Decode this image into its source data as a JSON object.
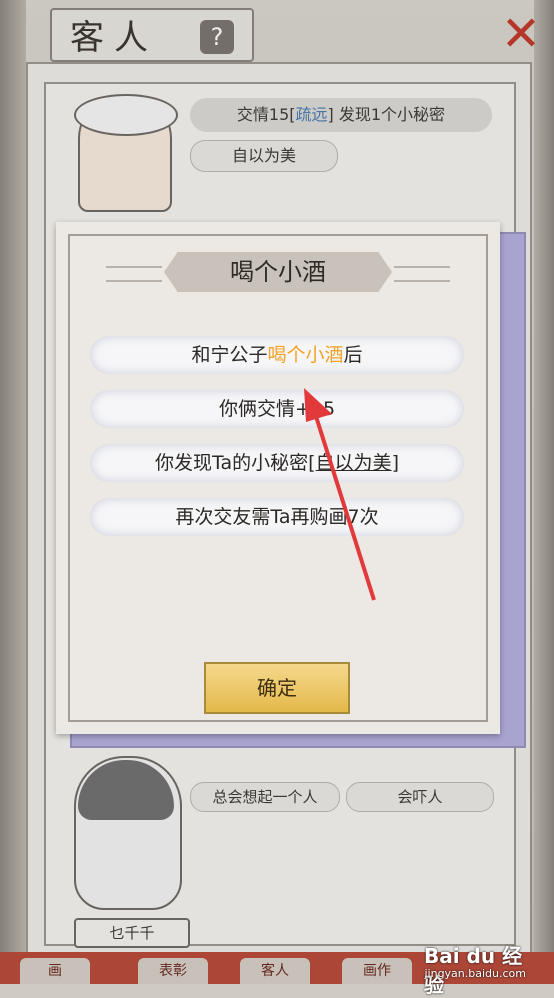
{
  "header": {
    "title": "客人",
    "help_symbol": "?",
    "close_symbol": "✕"
  },
  "top_guest": {
    "info_prefix": "交情15[",
    "info_link": "疏远",
    "info_suffix": "] 发现1个小秘密",
    "tag": "自以为美"
  },
  "bottom_guest": {
    "tags": [
      "总会想起一个人",
      "会吓人"
    ],
    "name": "乜千千"
  },
  "tabs": [
    "画",
    "表彰",
    "客人",
    "画作"
  ],
  "modal": {
    "title": "喝个小酒",
    "line1_prefix": "和宁公子",
    "line1_highlight": "喝个小酒",
    "line1_suffix": "后",
    "line2": "你俩交情+15",
    "line3_prefix": "你发现Ta的小秘密[",
    "line3_link": "自以为美",
    "line3_suffix": "]",
    "line4": "再次交友需Ta再购画7次",
    "confirm_label": "确定"
  },
  "watermark": {
    "brand": "Bai du 经验",
    "url": "jingyan.baidu.com"
  },
  "colors": {
    "highlight": "#f2a328",
    "link": "#4a7ab0",
    "arrow": "#e23a3a",
    "close": "#c0392b"
  }
}
